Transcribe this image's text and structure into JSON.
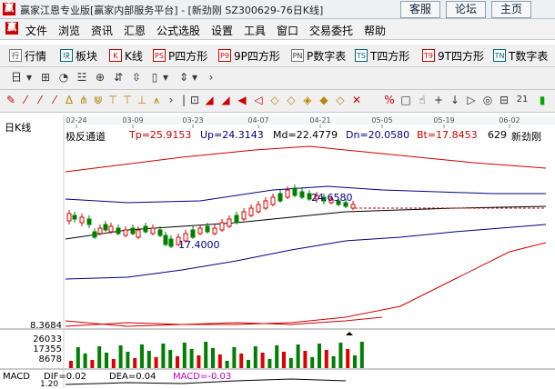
{
  "window": {
    "title": "赢家江恩专业版[赢家内部服务平台] - [新劲刚  SZ300629-76日K线]",
    "app_icon": "赢",
    "buttons": [
      "客服",
      "论坛",
      "主页"
    ]
  },
  "menu": {
    "logo": "赢",
    "items": [
      "文件",
      "浏览",
      "资讯",
      "汇恩",
      "公式选股",
      "设置",
      "工具",
      "窗口",
      "交易委托",
      "帮助"
    ]
  },
  "toolbar1": {
    "items": [
      {
        "icon": "行",
        "label": "行情"
      },
      {
        "icon": "块",
        "label": "板块"
      },
      {
        "icon": "K",
        "label": "K线"
      },
      {
        "icon": "PS",
        "label": "P四方形"
      },
      {
        "icon": "P9",
        "label": "9P四方形"
      },
      {
        "icon": "PN",
        "label": "P数字表"
      },
      {
        "icon": "TS",
        "label": "T四方形"
      },
      {
        "icon": "T9",
        "label": "9T四方形"
      },
      {
        "icon": "TN",
        "label": "T数字表"
      }
    ]
  },
  "toolbar2": {
    "symbols": [
      "日",
      "▾",
      "⊞",
      "◔",
      "☳",
      "⊕",
      "⇵",
      "⇳",
      "▯",
      "▾",
      "⇕",
      "▾",
      "›"
    ]
  },
  "toolbar3": {
    "symbols": [
      "✎",
      "⁄",
      "⁄",
      "⁄",
      "∆",
      "⋔",
      "⋓",
      "⊤",
      "⊤",
      "⊥",
      "⩚",
      "›",
      "|",
      "⊡",
      "◢",
      "◢",
      "◀",
      "◁",
      "◇",
      "◇",
      "◈",
      "◆",
      "◇",
      "✕",
      "%",
      "□",
      "☝",
      "+",
      "↓",
      "▷",
      "◎",
      "⊟",
      "21",
      "▮"
    ]
  },
  "chart": {
    "period": "日K线",
    "dates": [
      "02-24",
      "03-09",
      "03-23",
      "04-07",
      "04-21",
      "05-05",
      "05-19",
      "06-02"
    ],
    "indicator_name": "极反通道",
    "tp_label": "Tp=25.9153",
    "up_label": "Up=24.3143",
    "md_label": "Md=22.4779",
    "dn_label": "Dn=20.0580",
    "bt_label": "Bt=17.8453",
    "code": "629",
    "stock_name": "新劲刚",
    "high_annot": "24.6580",
    "low_annot": "17.4000",
    "vol_max_label": "8.3684",
    "vol_ticks": [
      "26033",
      "17355",
      "8678"
    ],
    "colors": {
      "up": "#e00000",
      "down": "#008000",
      "mid": "#000080",
      "outer": "#d00000",
      "dash": "#c00000"
    }
  },
  "macd": {
    "label": "MACD",
    "scale": "1.20",
    "dif": "DIF=0.02",
    "dea": "DEA=0.04",
    "macd": "MACD=-0.03"
  }
}
